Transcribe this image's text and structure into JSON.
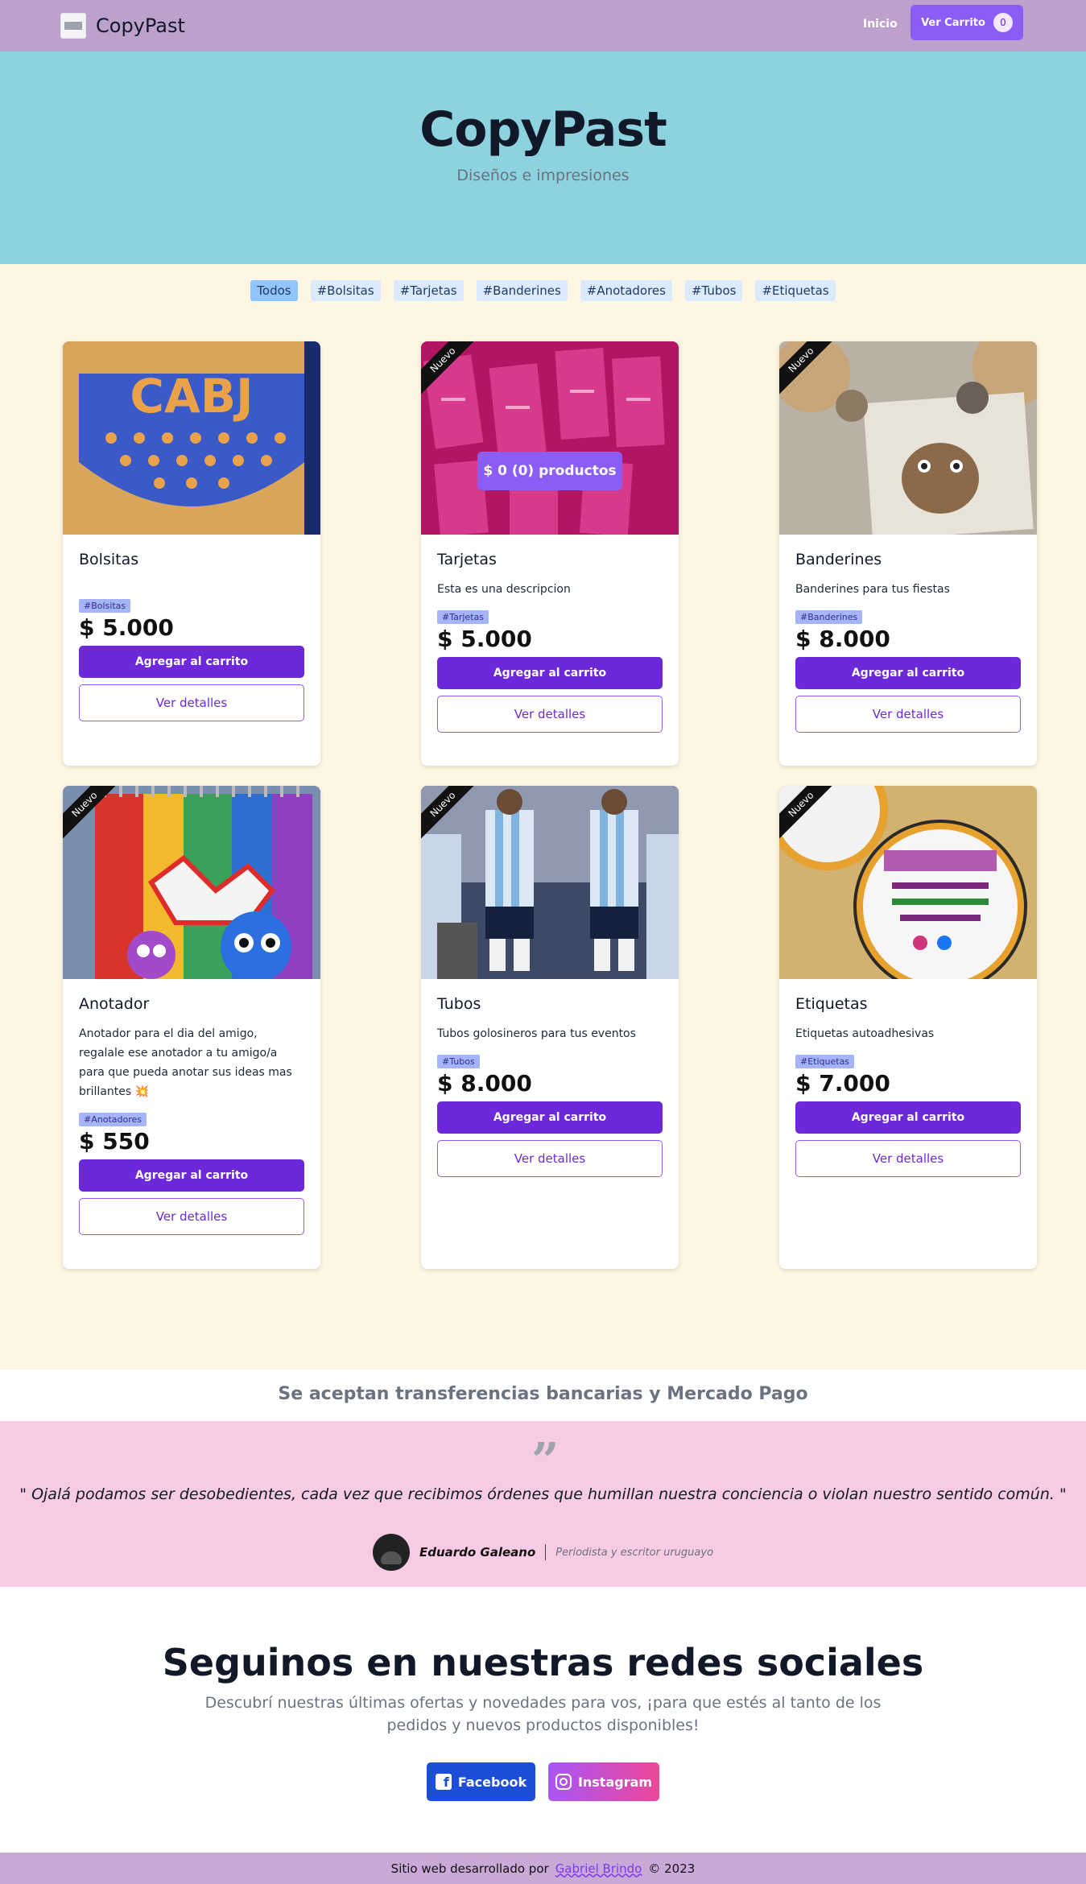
{
  "navbar": {
    "brand": "CopyPast",
    "inicio": "Inicio",
    "cart_label": "Ver Carrito",
    "cart_count": "0"
  },
  "hero": {
    "title": "CopyPast",
    "subtitle": "Diseños e impresiones"
  },
  "filters": [
    "Todos",
    "#Bolsitas",
    "#Tarjetas",
    "#Banderines",
    "#Anotadores",
    "#Tubos",
    "#Etiquetas"
  ],
  "overlay": "$ 0 (0) productos",
  "products": [
    {
      "title": "Bolsitas",
      "desc": "",
      "tag": "#Bolsitas",
      "price": "$ 5.000",
      "add": "Agregar al carrito",
      "details": "Ver detalles",
      "ribbon": "",
      "art_text": "CABJ"
    },
    {
      "title": "Tarjetas",
      "desc": "Esta es una descripcion",
      "tag": "#Tarjetas",
      "price": "$ 5.000",
      "add": "Agregar al carrito",
      "details": "Ver detalles",
      "ribbon": "Nuevo",
      "art_text": ""
    },
    {
      "title": "Banderines",
      "desc": "Banderines para tus fiestas",
      "tag": "#Banderines",
      "price": "$ 8.000",
      "add": "Agregar al carrito",
      "details": "Ver detalles",
      "ribbon": "Nuevo",
      "art_text": ""
    },
    {
      "title": "Anotador",
      "desc": "Anotador para el dia del amigo, regalale ese anotador a tu amigo/a para que pueda anotar sus ideas mas brillantes 💥",
      "tag": "#Anotadores",
      "price": "$ 550",
      "add": "Agregar al carrito",
      "details": "Ver detalles",
      "ribbon": "Nuevo",
      "art_text": ""
    },
    {
      "title": "Tubos",
      "desc": "Tubos golosineros para tus eventos",
      "tag": "#Tubos",
      "price": "$ 8.000",
      "add": "Agregar al carrito",
      "details": "Ver detalles",
      "ribbon": "Nuevo",
      "art_text": ""
    },
    {
      "title": "Etiquetas",
      "desc": "Etiquetas autoadhesivas",
      "tag": "#Etiquetas",
      "price": "$ 7.000",
      "add": "Agregar al carrito",
      "details": "Ver detalles",
      "ribbon": "Nuevo",
      "art_text": ""
    }
  ],
  "payment": "Se aceptan transferencias bancarias y Mercado Pago",
  "quote": {
    "text": "\" Ojalá podamos ser desobedientes, cada vez que recibimos órdenes que humillan nuestra conciencia o violan nuestro sentido común. \"",
    "author": "Eduardo Galeano",
    "role": "Periodista y escritor uruguayo"
  },
  "social": {
    "title": "Seguinos en nuestras redes sociales",
    "desc": "Descubrí nuestras últimas ofertas y novedades para vos, ¡para que estés al tanto de los pedidos y nuevos productos disponibles!",
    "facebook": "Facebook",
    "instagram": "Instagram"
  },
  "footer": {
    "prefix": "Sitio web desarrollado por",
    "author": "Gabriel Brindo",
    "suffix": "© 2023"
  }
}
